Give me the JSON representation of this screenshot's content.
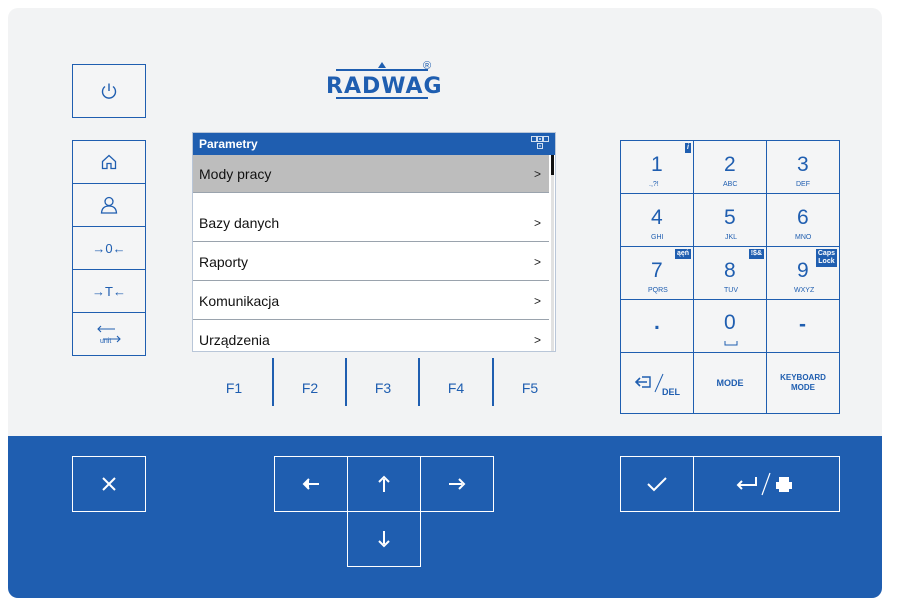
{
  "brand": {
    "logo_text": "RADWAG",
    "registered": "®"
  },
  "screen": {
    "title": "Parametry",
    "menu": [
      {
        "label": "Mody pracy",
        "chevron": ">",
        "selected": true
      },
      {
        "label": "Bazy danych",
        "chevron": ">"
      },
      {
        "label": "Raporty",
        "chevron": ">"
      },
      {
        "label": "Komunikacja",
        "chevron": ">"
      },
      {
        "label": "Urządzenia",
        "chevron": ">"
      }
    ]
  },
  "left_keys": {
    "zero": "→0←",
    "tare": "→T←",
    "unit": "unit"
  },
  "function_keys": [
    "F1",
    "F2",
    "F3",
    "F4",
    "F5"
  ],
  "keypad": {
    "k1": {
      "main": "1",
      "sub": ".,?!",
      "badge": "i"
    },
    "k2": {
      "main": "2",
      "sub": "ABC"
    },
    "k3": {
      "main": "3",
      "sub": "DEF"
    },
    "k4": {
      "main": "4",
      "sub": "GHI"
    },
    "k5": {
      "main": "5",
      "sub": "JKL"
    },
    "k6": {
      "main": "6",
      "sub": "MNO"
    },
    "k7": {
      "main": "7",
      "sub": "PQRS",
      "badge": "ąęń"
    },
    "k8": {
      "main": "8",
      "sub": "TUV",
      "badge": "!$&"
    },
    "k9": {
      "main": "9",
      "sub": "WXYZ",
      "badge_line1": "Caps",
      "badge_line2": "Lock"
    },
    "dot": ".",
    "k0": {
      "main": "0"
    },
    "minus": "-",
    "del": "DEL",
    "mode": "MODE",
    "kbd_mode_1": "KEYBOARD",
    "kbd_mode_2": "MODE"
  },
  "icons": {
    "power": "power-icon",
    "home": "home-icon",
    "user": "user-icon",
    "close": "close-icon",
    "arrows": [
      "arrow-left-icon",
      "arrow-up-icon",
      "arrow-right-icon",
      "arrow-down-icon"
    ],
    "ok": "check-icon",
    "enter_print": "enter-print-icon"
  },
  "colors": {
    "accent": "#1f5eb0",
    "panel": "#f2f3f4",
    "selected_row": "#bdbdbd"
  }
}
